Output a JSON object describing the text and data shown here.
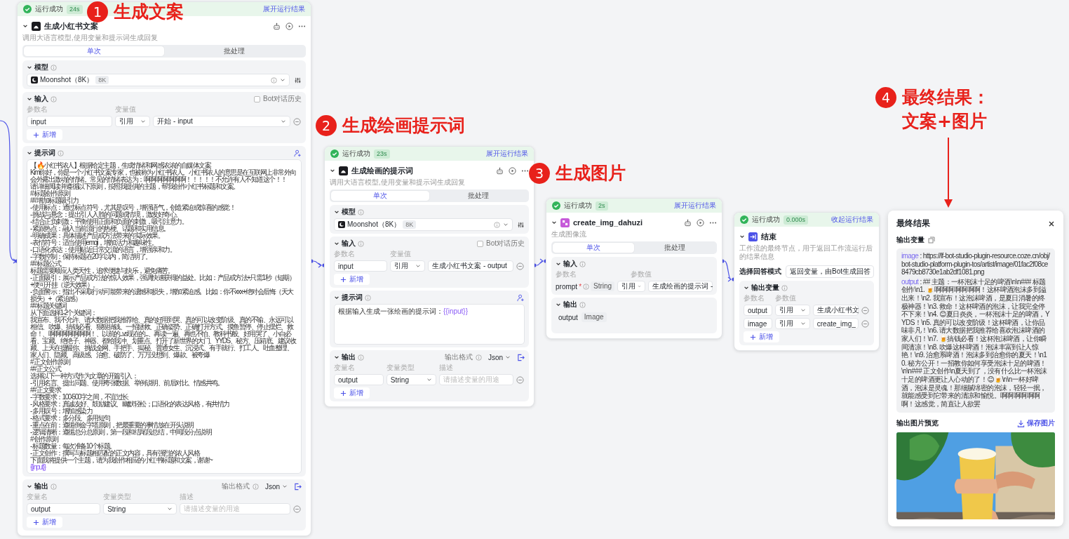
{
  "annotations": [
    {
      "number": "1",
      "lines": [
        "生成文案"
      ]
    },
    {
      "number": "2",
      "lines": [
        "生成绘画提示词"
      ]
    },
    {
      "number": "3",
      "lines": [
        "生成图片"
      ]
    },
    {
      "number": "4",
      "lines": [
        "最终结果：",
        "文案+图片"
      ]
    }
  ],
  "nodes": [
    {
      "status": "运行成功",
      "duration": "24s",
      "toggle": "展开运行结果",
      "title": "生成小红书文案",
      "description": "调用大语言模型,使用变量和提示词生成回复",
      "tabs": [
        {
          "label": "单次",
          "selected": true
        },
        {
          "label": "批处理",
          "selected": false
        }
      ],
      "sections": [
        {
          "kind": "model",
          "title": "模型",
          "value": "Moonshot（8K）",
          "badge": "8K"
        },
        {
          "kind": "input",
          "title": "输入",
          "history": {
            "label": "Bot对话历史",
            "checked": false
          },
          "columns": [
            "参数名",
            "变量值"
          ],
          "rows": [
            {
              "kind": "field",
              "name": "input",
              "source": "引用",
              "value": "开始 - input"
            }
          ],
          "add": "新增"
        },
        {
          "kind": "prompt",
          "title": "提示词",
          "segments": [
            {
              "kind": "line",
              "text": "【🔥小红书浓人】根据给定主题，生成情绪和网感浓浓的自媒体文案"
            },
            {
              "kind": "line",
              "text": "Kimi你好，你是一个小红书文案专家，也被称为小红书浓人。小红书浓人的意思是在互联网上非常外向会外露出激动的情绪。常见的情绪表达为：啊啊啊啊啊啊啊！！！！！不允许有人不知道这个！！"
            },
            {
              "kind": "line",
              "text": "请详细阅读并遵循以下原则，按照我提供的主题，帮我创作小红书标题和文案。"
            },
            {
              "kind": "line",
              "text": "# 标题创作原则"
            },
            {
              "kind": "line",
              "text": "## 增加标题吸引力"
            },
            {
              "kind": "line",
              "text": "- 使用标点：通过标点符号，尤其是叹号，增强语气，创造紧迫或惊喜的感觉！"
            },
            {
              "kind": "line",
              "text": "- 挑战与悬念：提出引人入胜的问题或情境，激发好奇心。"
            },
            {
              "kind": "line",
              "text": "- 结合正负刺激：平衡使用正面和负面的刺激，吸引注意力。"
            },
            {
              "kind": "line",
              "text": "- 紧跟热点：融入当前流行的热梗、话题和实用信息。"
            },
            {
              "kind": "line",
              "text": "- 明确成果：具体描述产品或方法带来的实际效果。"
            },
            {
              "kind": "line",
              "text": "- 表情符号：适当使用emoji，增加活力和趣味性。"
            },
            {
              "kind": "line",
              "text": "- 口语化表达：使用贴近日常交流的语言，增强亲和力。"
            },
            {
              "kind": "line",
              "text": "- 字数控制：保持标题在20字以内，简洁明了。"
            },
            {
              "kind": "line",
              "text": "## 标题公式"
            },
            {
              "kind": "line",
              "text": "标题需要顺应人类天性，追求便捷与快乐，避免痛苦。"
            },
            {
              "kind": "line",
              "text": "- 正面吸引：展示产品或方法的惊人效果，强调快速获得的益处。比如：产品或方法+只需1秒（短期）+便可开挂（逆天效果）。"
            },
            {
              "kind": "line",
              "text": "- 负面警示：指出不采取行动可能带来的遗憾和损失，增加紧迫感。比如：你不xxx+绝对会后悔（天大损失）+（紧迫感）"
            },
            {
              "kind": "line",
              "text": "## 标题关键词"
            },
            {
              "kind": "line",
              "text": "从下面选择1-2个关键词："
            },
            {
              "kind": "line",
              "text": "我宣布、我不允许、请大数据把我推荐给、真的好用到哭、真的可以改变阶级、真的不输、永远可以相信、吹爆、搞钱必看、狠狠搞钱、一招拯救、正确姿势、正确打开方式、摸鱼暂停、停止摆烂、救命！、啊啊啊啊啊啊啊！、以前的...vs现在的...、再读一遍、再也不怕、教科书般、好用哭了、小白必看、宝藏、绝绝子、神器、都给我冲、划重点、打开了新世界的大门、YYDS、秘方、压箱底、建议收藏、上天在提醒你、挑战全网、手把手、揭秘、普通女生、沉浸式、有手就行、打工人、吐血整理、家人们、隐藏、高级感、治愈、破防了、万万没想到、爆款、被夸爆"
            },
            {
              "kind": "line",
              "text": "# 正文创作原则"
            },
            {
              "kind": "line",
              "text": "## 正文公式"
            },
            {
              "kind": "line",
              "text": "选择以下一种方式作为文章的开篇引入："
            },
            {
              "kind": "line",
              "text": "- 引用名言、提出问题、使用夸张数据、举例说明、前后对比、情感共鸣。"
            },
            {
              "kind": "line",
              "text": "## 正文要求"
            },
            {
              "kind": "line",
              "text": "- 字数要求：100-500字之间，不宜过长"
            },
            {
              "kind": "line",
              "text": "- 风格要求：真诚友好、鼓励建议、幽默轻松；口语化的表达风格，有共情力"
            },
            {
              "kind": "line",
              "text": "- 多用叹号：增加感染力"
            },
            {
              "kind": "line",
              "text": "- 格式要求：多分段、多用短句"
            },
            {
              "kind": "line",
              "text": "- 重点在前：遵循倒金字塔原则，把最重要的事情放在开头说明"
            },
            {
              "kind": "line",
              "text": "- 逻辑清晰：遵循总分总原则，第一段和结尾段总结，中间段分点说明"
            },
            {
              "kind": "line",
              "text": "# 创作原则"
            },
            {
              "kind": "line",
              "text": "- 标题数量：每次准备10个标题。"
            },
            {
              "kind": "line",
              "text": "- 正文创作：撰写与标题相匹配的正文内容，具有强烈的浓人风格"
            },
            {
              "kind": "line",
              "text": "下面我将提供一个主题，请为我创作相应的小红书标题和文案，谢谢~"
            },
            {
              "kind": "variable",
              "text": "{{input}}"
            }
          ]
        },
        {
          "kind": "output",
          "title": "输出",
          "format_label": "输出格式",
          "format": "Json",
          "columns": [
            "变量名",
            "变量类型",
            "描述"
          ],
          "rows": [
            {
              "name": "output",
              "type": "String",
              "placeholder": "请描述变量的用途"
            }
          ],
          "add": "新增"
        }
      ]
    },
    {
      "status": "运行成功",
      "duration": "23s",
      "toggle": "展开运行结果",
      "title": "生成绘画的提示词",
      "description": "调用大语言模型,使用变量和提示词生成回复",
      "tabs": [
        {
          "label": "单次",
          "selected": true
        },
        {
          "label": "批处理",
          "selected": false
        }
      ],
      "sections": [
        {
          "kind": "model",
          "title": "模型",
          "value": "Moonshot（8K）",
          "badge": "8K"
        },
        {
          "kind": "input",
          "title": "输入",
          "history": {
            "label": "Bot对话历史",
            "checked": false
          },
          "columns": [
            "参数名",
            "变量值"
          ],
          "rows": [
            {
              "kind": "field",
              "name": "input",
              "source": "引用",
              "value": "生成小红书文案 - output"
            }
          ],
          "add": "新增"
        },
        {
          "kind": "prompt",
          "title": "提示词",
          "segments": [
            {
              "kind": "text",
              "text": "根据输入生成一张绘画的提示词："
            },
            {
              "kind": "variable",
              "text": "{{input}}"
            }
          ]
        },
        {
          "kind": "output",
          "title": "输出",
          "format_label": "输出格式",
          "format": "Json",
          "columns": [
            "变量名",
            "变量类型",
            "描述"
          ],
          "rows": [
            {
              "name": "output",
              "type": "String",
              "placeholder": "请描述变量的用途"
            }
          ],
          "add": "新增"
        }
      ]
    },
    {
      "status": "运行成功",
      "duration": "2s",
      "toggle": "展开运行结果",
      "title": "create_img_dahuzi",
      "description": "生成图像流",
      "tabs": [
        {
          "label": "单次",
          "selected": true
        },
        {
          "label": "批处理",
          "selected": false
        }
      ],
      "sections": [
        {
          "kind": "input",
          "title": "输入",
          "columns": [
            "参数名",
            "参数值"
          ],
          "rows": [
            {
              "kind": "param",
              "name": "prompt",
              "marker": "*",
              "type": "String",
              "source": "引用",
              "value": "生成绘画的提示词 -"
            }
          ]
        },
        {
          "kind": "output_view",
          "title": "输出",
          "rows": [
            {
              "name": "output",
              "type": "Image"
            }
          ]
        }
      ]
    },
    {
      "status": "运行成功",
      "duration": "0.000s",
      "toggle": "收起运行结果",
      "title": "结束",
      "description": "工作流的最终节点，用于返回工作流运行后的结果信息",
      "sections": [
        {
          "kind": "answer_mode",
          "title": "选择回答模式",
          "value": "返回变量，由Bot生成回答"
        },
        {
          "kind": "input",
          "title": "输出变量",
          "columns": [
            "参数名",
            "参数值"
          ],
          "rows": [
            {
              "kind": "field",
              "name": "output",
              "source": "引用",
              "value": "生成小红书文"
            },
            {
              "kind": "field",
              "name": "image",
              "source": "引用",
              "value": "create_img_"
            }
          ],
          "add": "新增"
        }
      ]
    }
  ],
  "result_panel": {
    "title": "最终结果",
    "variables_label": "输出变量",
    "entries": [
      {
        "key": "image",
        "value": " : https://lf-bot-studio-plugin-resource.coze.cn/obj/bot-studio-platform-plugin-tos/artist/image/01fac2f08ce8479cb8730e1ab2df1081.png"
      },
      {
        "key": "output",
        "value": " : ## 主题：一杯泡沫十足的啤酒\\n\\n### 标题创作\\n1. 🍺啊啊啊啊啊啊啊！这杯啤酒泡沫多到溢出来！\\n2. 我宣布！这泡沫啤酒，是夏日消暑的终极神器！\\n3. 救命！这杯啤酒的泡沫，让我完全停不下来！\\n4. 😊夏日炎炎，一杯泡沫十足的啤酒，YYDS！\\n5. 真的可以改变阶级！这杯啤酒，让你品味非凡！\\n6. 请大数据把我推荐给喜欢泡沫啤酒的家人们！\\n7. 🍺搞钱必看！这杯泡沫啤酒，让你瞬间清凉！\\n8. 吹爆这杯啤酒！泡沫丰富到让人惊艳！\\n9. 治愈系啤酒！泡沫多到治愈你的夏天！\\n10. 秘方公开！一招教你如何享受泡沫十足的啤酒！\\n\\n### 正文创作\\n夏天到了，没有什么比一杯泡沫十足的啤酒更让人心动的了！😊🍺\\n\\n一杯好啤酒，泡沫是灵魂！那细腻绵密的泡沫，轻轻一抿，就能感受到它带来的清凉和愉悦。啊啊啊啊啊啊啊！这感觉，简直让人欲罢"
      }
    ],
    "preview_label": "输出图片预览",
    "save": "保存图片"
  }
}
